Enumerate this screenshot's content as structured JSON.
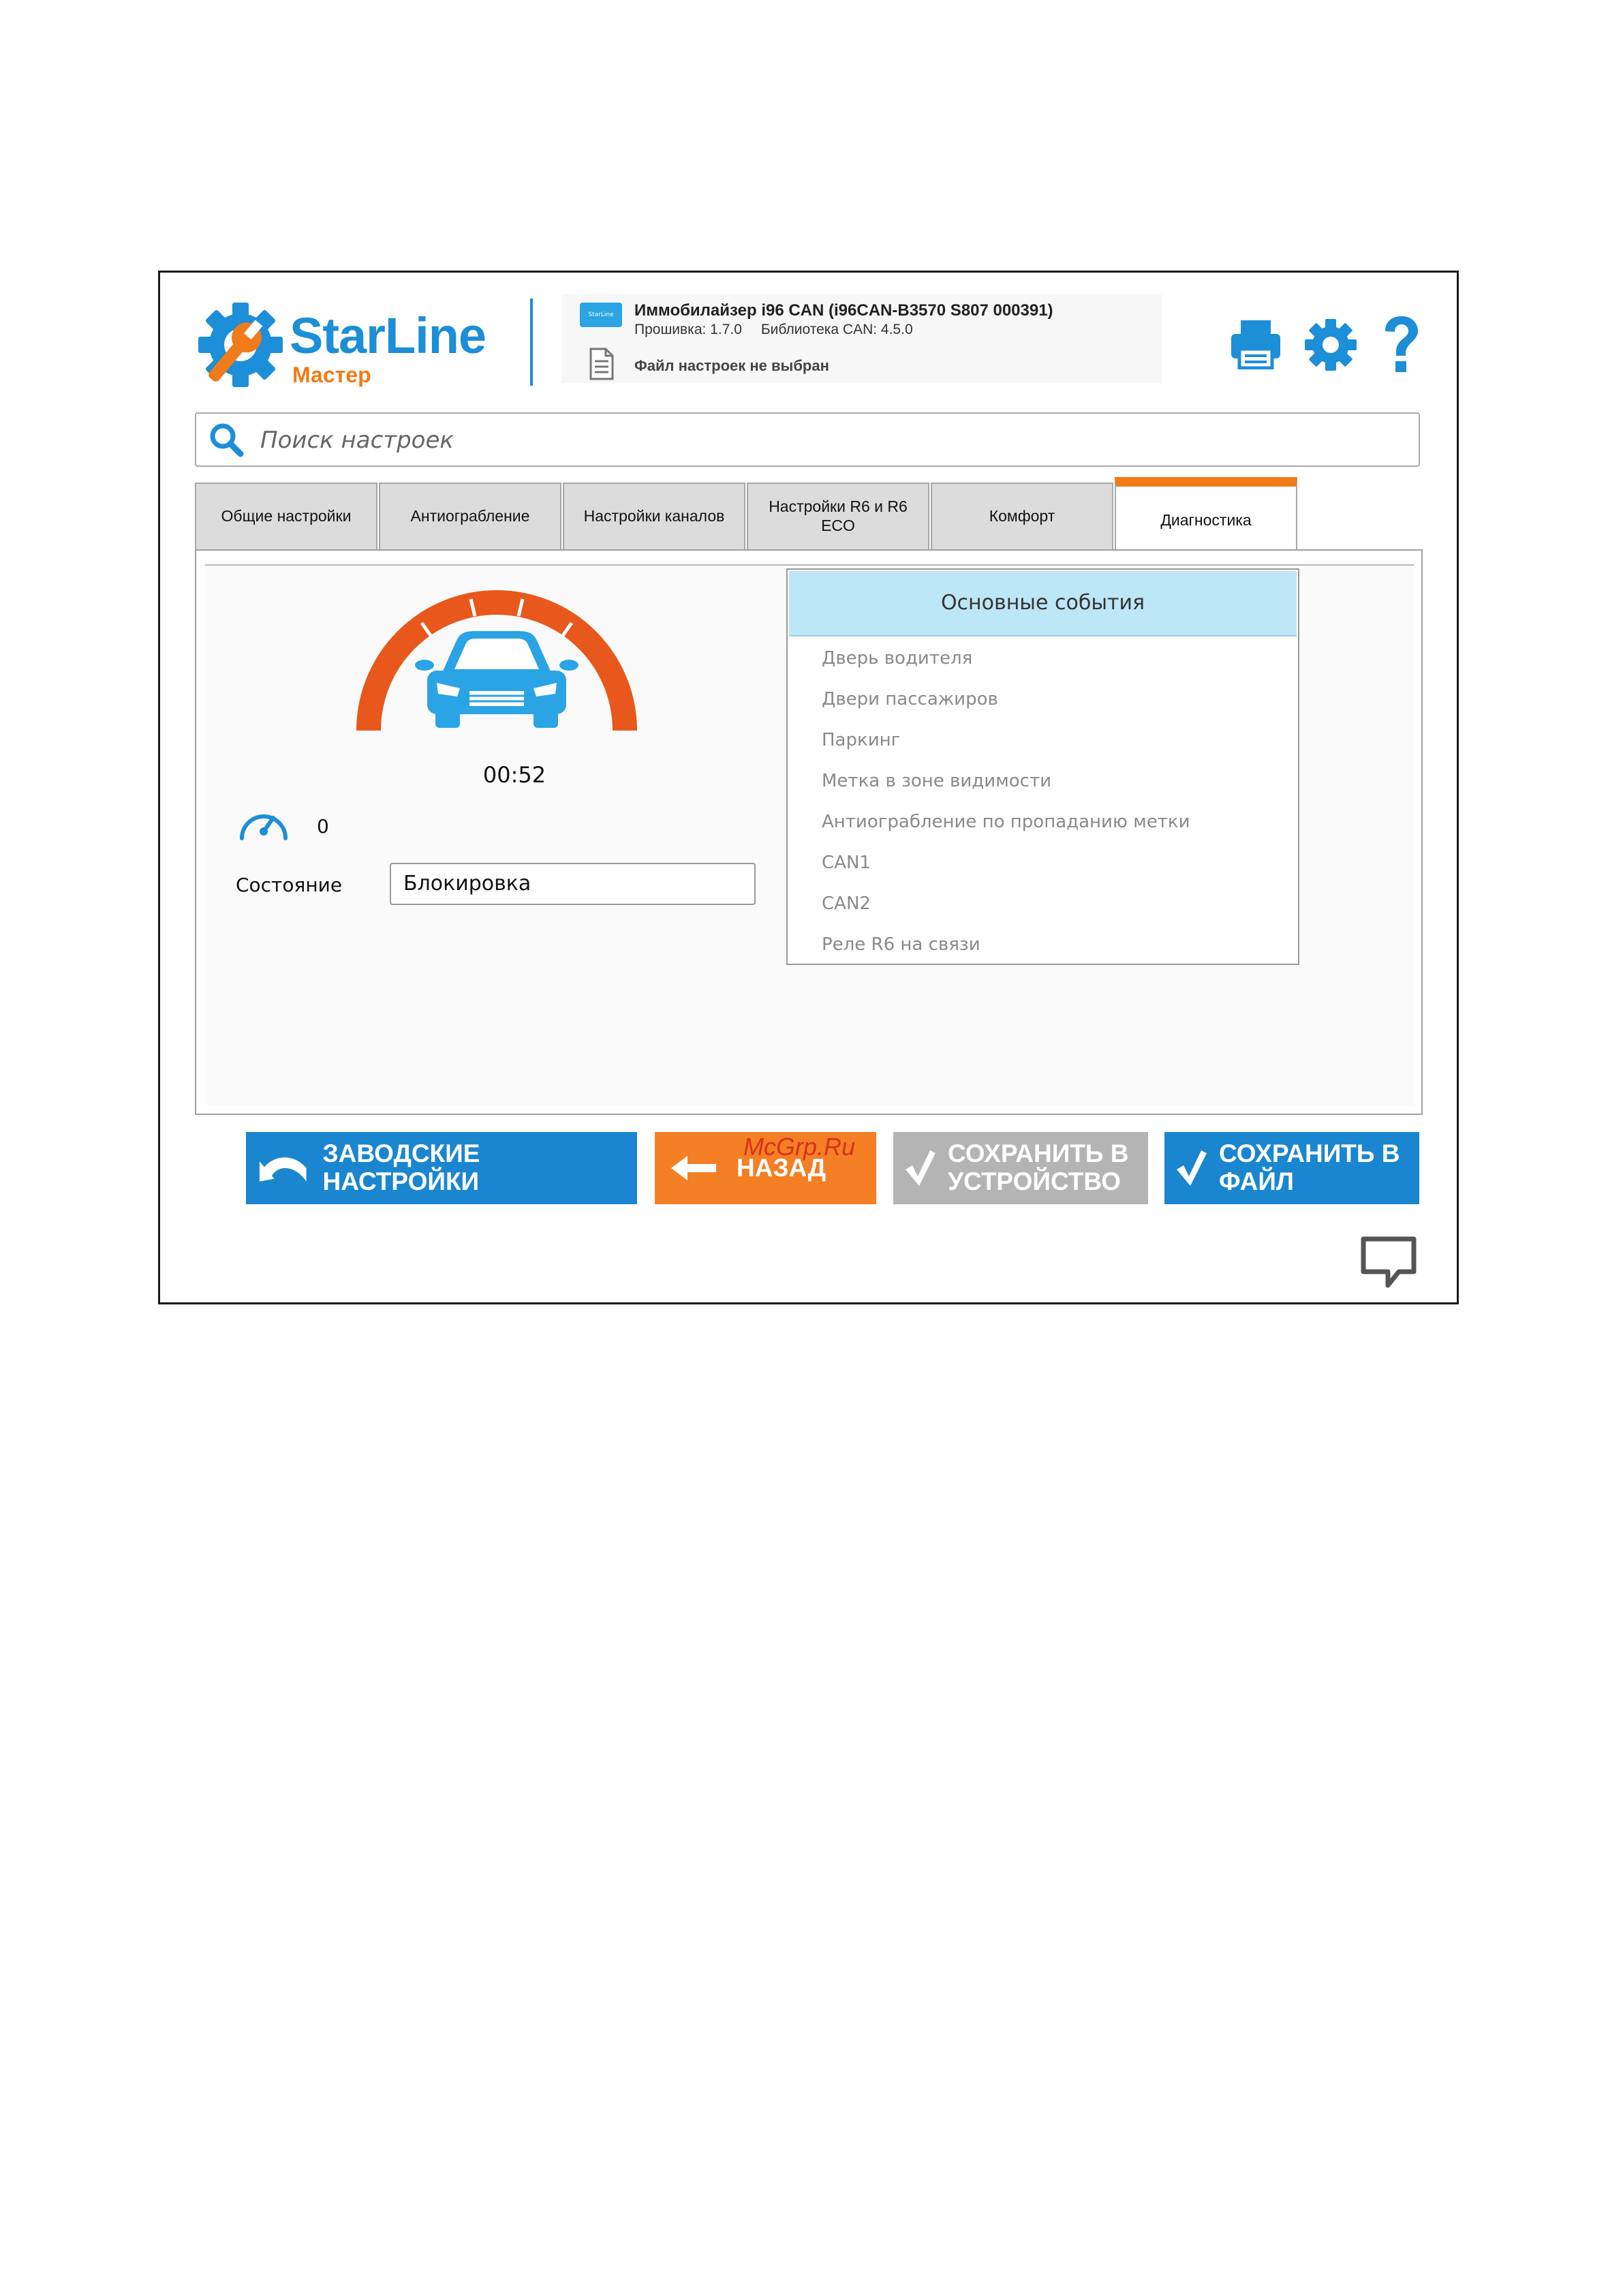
{
  "app": {
    "logo_text": "StarLine",
    "logo_sub": "Мастер"
  },
  "device": {
    "badge": "StarLine",
    "name": "Иммобилайзер i96 CAN (i96CAN-B3570 S807 000391)",
    "firmware": "Прошивка: 1.7.0",
    "can_library": "Библиотека CAN: 4.5.0",
    "settings_file": "Файл настроек не выбран"
  },
  "header_icons": [
    "printer-icon",
    "gear-icon",
    "help-icon"
  ],
  "search": {
    "placeholder": "Поиск настроек"
  },
  "tabs": [
    {
      "label": "Общие настройки",
      "active": false
    },
    {
      "label": "Антиограбление",
      "active": false
    },
    {
      "label": "Настройки каналов",
      "active": false
    },
    {
      "label": "Настройки R6 и R6 ECO",
      "active": false
    },
    {
      "label": "Комфорт",
      "active": false
    },
    {
      "label": "Диагностика",
      "active": true
    }
  ],
  "diagnostics": {
    "timer": "00:52",
    "speed": "0",
    "state_label": "Состояние",
    "state_value": "Блокировка",
    "events_title": "Основные события",
    "events": [
      "Дверь водителя",
      "Двери пассажиров",
      "Паркинг",
      "Метка в зоне видимости",
      "Антиограбление по пропаданию метки",
      "CAN1",
      "CAN2",
      "Реле R6 на связи"
    ]
  },
  "buttons": {
    "factory": "ЗАВОДСКИЕ НАСТРОЙКИ",
    "back": "НАЗАД",
    "save_device_1": "СОХРАНИТЬ В",
    "save_device_2": "УСТРОЙСТВО",
    "save_file_1": "СОХРАНИТЬ В",
    "save_file_2": "ФАЙЛ"
  },
  "watermark": "McGrp.Ru",
  "colors": {
    "brand_blue": "#1d8ed8",
    "brand_orange": "#f07b1a",
    "button_blue": "#1a86d0",
    "button_orange": "#f47f25",
    "button_disabled": "#b4b4b4",
    "events_header": "#bde6f7"
  }
}
